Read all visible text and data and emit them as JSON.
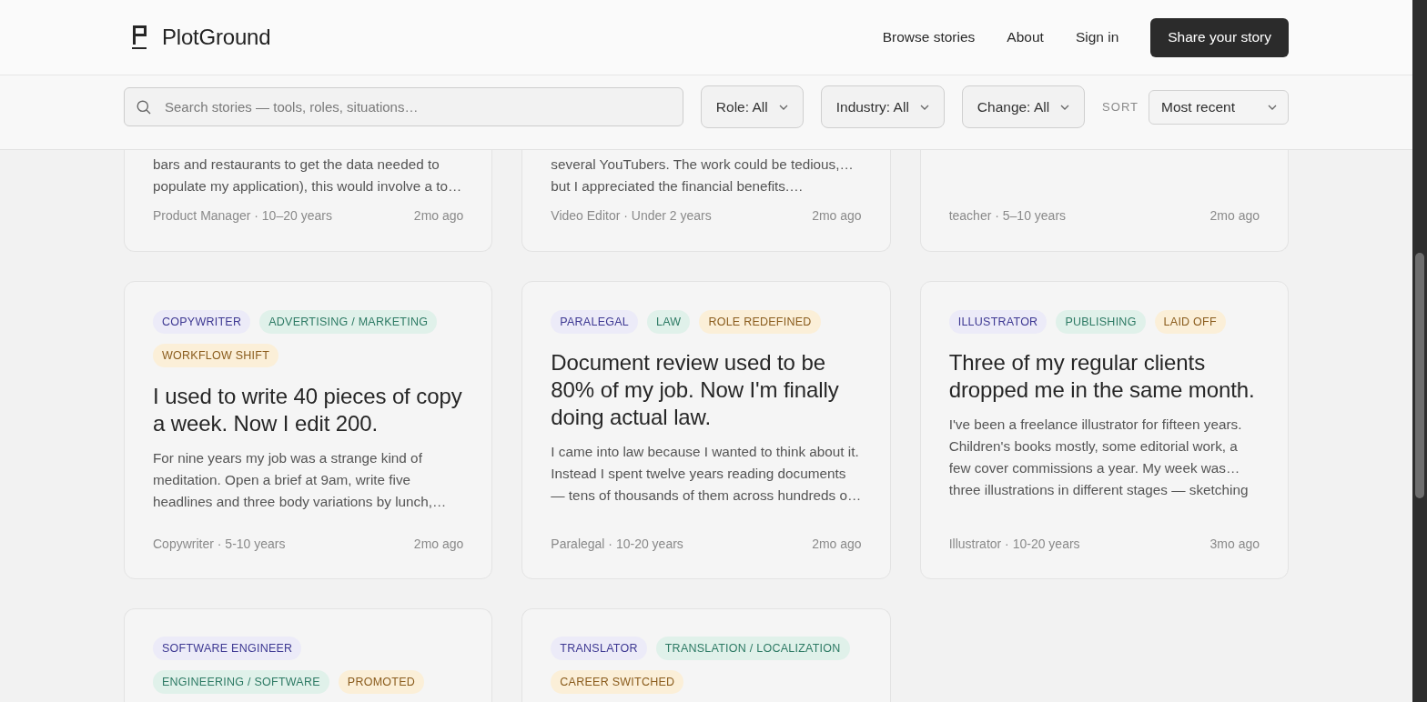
{
  "header": {
    "brand": "PlotGround",
    "nav": [
      {
        "label": "Browse stories"
      },
      {
        "label": "About"
      },
      {
        "label": "Sign in"
      }
    ],
    "cta": "Share your story"
  },
  "filters": {
    "search": {
      "placeholder": "Search stories — tools, roles, situations…"
    },
    "dropdowns": [
      {
        "label": "Role: All"
      },
      {
        "label": "Industry: All"
      },
      {
        "label": "Change: All"
      }
    ],
    "sort_label": "SORT",
    "sort": {
      "value": "Most recent"
    }
  },
  "stories": [
    {
      "kind": "cut_top",
      "excerpt": "bars and restaurants to get the data needed to populate my application), this would involve a to…",
      "author": "Product Manager · 10–20 years",
      "age": "2mo ago"
    },
    {
      "kind": "cut_top",
      "excerpt": "several YouTubers. The work could be tedious,… but I appreciated the financial benefits.…",
      "author": "Video Editor · Under 2 years",
      "age": "2mo ago"
    },
    {
      "kind": "cut_top",
      "author": "teacher · 5–10 years",
      "age": "2mo ago"
    },
    {
      "kind": "full",
      "tags": [
        {
          "kind": "role",
          "label": "COPYWRITER"
        },
        {
          "kind": "industry",
          "label": "ADVERTISING / MARKETING"
        },
        {
          "kind": "change",
          "label": "WORKFLOW SHIFT"
        }
      ],
      "title": "I used to write 40 pieces of copy a week. Now I edit 200.",
      "excerpt": "For nine years my job was a strange kind of meditation. Open a brief at 9am, write five headlines and three body variations by lunch,…",
      "author": "Copywriter · 5-10 years",
      "age": "2mo ago"
    },
    {
      "kind": "full",
      "tags": [
        {
          "kind": "role",
          "label": "PARALEGAL"
        },
        {
          "kind": "industry",
          "label": "LAW"
        },
        {
          "kind": "change",
          "label": "ROLE REDEFINED"
        }
      ],
      "title": "Document review used to be 80% of my job. Now I'm finally doing actual law.",
      "excerpt": "I came into law because I wanted to think about it. Instead I spent twelve years reading documents — tens of thousands of them across hundreds o…",
      "author": "Paralegal · 10-20 years",
      "age": "2mo ago"
    },
    {
      "kind": "full",
      "tags": [
        {
          "kind": "role",
          "label": "ILLUSTRATOR"
        },
        {
          "kind": "industry",
          "label": "PUBLISHING"
        },
        {
          "kind": "change",
          "label": "LAID OFF"
        }
      ],
      "title": "Three of my regular clients dropped me in the same month.",
      "excerpt": "I've been a freelance illustrator for fifteen years. Children's books mostly, some editorial work, a few cover commissions a year. My week was… three illustrations in different stages — sketching",
      "author": "Illustrator · 10-20 years",
      "age": "3mo ago"
    },
    {
      "kind": "cut_bottom",
      "tags": [
        {
          "kind": "role",
          "label": "SOFTWARE ENGINEER"
        },
        {
          "kind": "industry",
          "label": "ENGINEERING / SOFTWARE"
        },
        {
          "kind": "change",
          "label": "PROMOTED"
        }
      ]
    },
    {
      "kind": "cut_bottom",
      "tags": [
        {
          "kind": "role",
          "label": "TRANSLATOR"
        },
        {
          "kind": "industry",
          "label": "TRANSLATION / LOCALIZATION"
        },
        {
          "kind": "change",
          "label": "CAREER SWITCHED"
        }
      ]
    }
  ]
}
